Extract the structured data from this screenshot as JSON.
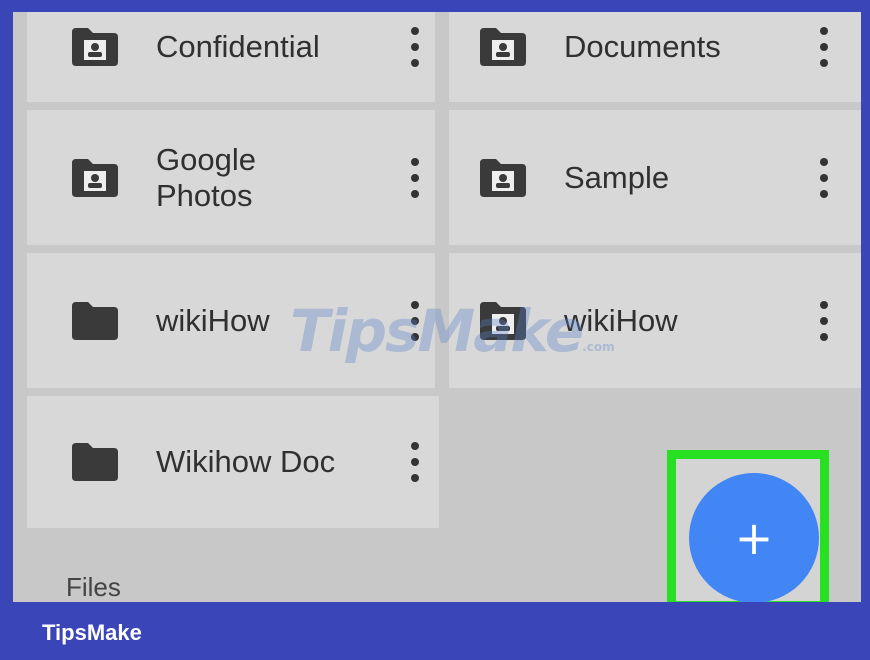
{
  "folders": [
    {
      "label": "Confidential"
    },
    {
      "label": "Documents"
    },
    {
      "label": "Google Photos"
    },
    {
      "label": "Sample"
    },
    {
      "label": "wikiHow"
    },
    {
      "label": "wikiHow"
    },
    {
      "label": "Wikihow Doc"
    }
  ],
  "section": {
    "files_label": "Files"
  },
  "fab": {
    "glyph": "+"
  },
  "watermark": {
    "text": "TipsMake",
    "suffix": ".com"
  },
  "brand": {
    "text": "TipsMake"
  },
  "colors": {
    "fab": "#4285f4",
    "highlight": "#27e021",
    "bar": "#3a46b8"
  },
  "icons": {
    "shared": "shared-folder-icon",
    "plain": "folder-icon",
    "more": "more-vert-icon",
    "add": "add-icon"
  }
}
